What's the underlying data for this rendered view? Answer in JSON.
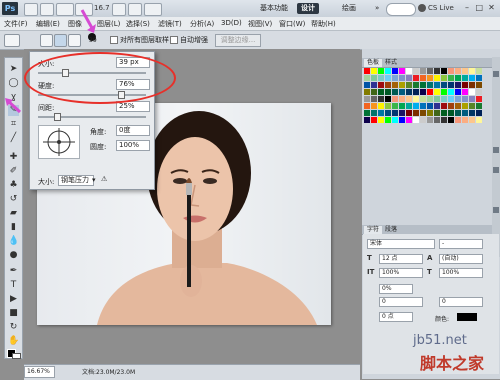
{
  "app": {
    "logo_text": "Ps",
    "zoom_readout": "16.7",
    "workspaces": [
      "基本功能",
      "设计",
      "绘画"
    ],
    "workspace_more": "»",
    "cs_live": "CS Live",
    "window_controls": [
      "–",
      "□",
      "✕"
    ]
  },
  "menu": [
    "文件(F)",
    "编辑(E)",
    "图像",
    "图层(L)",
    "选择(S)",
    "滤镜(T)",
    "分析(A)",
    "3D(D)",
    "视图(V)",
    "窗口(W)",
    "帮助(H)"
  ],
  "options_bar": {
    "brush_size": "39",
    "sample_all_layers": "对所有图层取样",
    "auto_enhance": "自动增强",
    "refine_edge": "调整边缘..."
  },
  "brush_popup": {
    "size_label": "大小:",
    "size_value": "39 px",
    "hardness_label": "硬度:",
    "hardness_value": "76%",
    "spacing_label": "间距:",
    "spacing_value": "25%",
    "angle_label": "角度:",
    "angle_value": "0度",
    "roundness_label": "圆度:",
    "roundness_value": "100%",
    "size_mode_label": "大小:",
    "size_mode_value": "钢笔压力",
    "size_mode_arrow": "▾",
    "warning": "⚠"
  },
  "panels": {
    "swatches_tabs": [
      "色板",
      "样式"
    ],
    "character_tabs": [
      "字符",
      "段落"
    ],
    "character": {
      "font_family": "宋体",
      "font_style": "-",
      "font_size": "12 点",
      "leading": "(自动)",
      "v_scale": "100%",
      "h_scale": "100%",
      "tracking_pct": "0%",
      "kerning": "0",
      "tracking": "0",
      "baseline": "0 点",
      "color_label": "颜色:"
    },
    "colors": {
      "swatch_palette": [
        "#ff0000",
        "#ffff00",
        "#00ff00",
        "#00ffff",
        "#0000ff",
        "#ff00ff",
        "#ffffff",
        "#cccccc",
        "#999999",
        "#666666",
        "#333333",
        "#000000",
        "#f7977a",
        "#fbad82",
        "#fdc68c",
        "#fff799",
        "#c6df9c",
        "#a4d49d",
        "#81ca9d",
        "#7bcdc8",
        "#6ccff7",
        "#7ca6d8",
        "#8293ca",
        "#8881be",
        "#ed1c24",
        "#f26522",
        "#f7941d",
        "#fff200",
        "#8dc63f",
        "#39b54a",
        "#00a651",
        "#00a99d",
        "#00aeef",
        "#0072bc",
        "#0054a6",
        "#2e3192",
        "#9e0b0f",
        "#a0410d",
        "#a36209",
        "#aba000",
        "#598527",
        "#1a7b30",
        "#007236",
        "#00746b",
        "#0076a3",
        "#004b80",
        "#003471",
        "#1b1464",
        "#790000",
        "#7b2e00",
        "#7d4900",
        "#827b00",
        "#406618",
        "#005e20",
        "#005826",
        "#005952",
        "#005b7f",
        "#003663",
        "#002157",
        "#0d004c"
      ]
    }
  },
  "status": {
    "zoom": "16.67%",
    "doc_info": "文档:23.0M/23.0M"
  },
  "watermark": {
    "url": "jb51.net",
    "name": "脚本之家"
  }
}
